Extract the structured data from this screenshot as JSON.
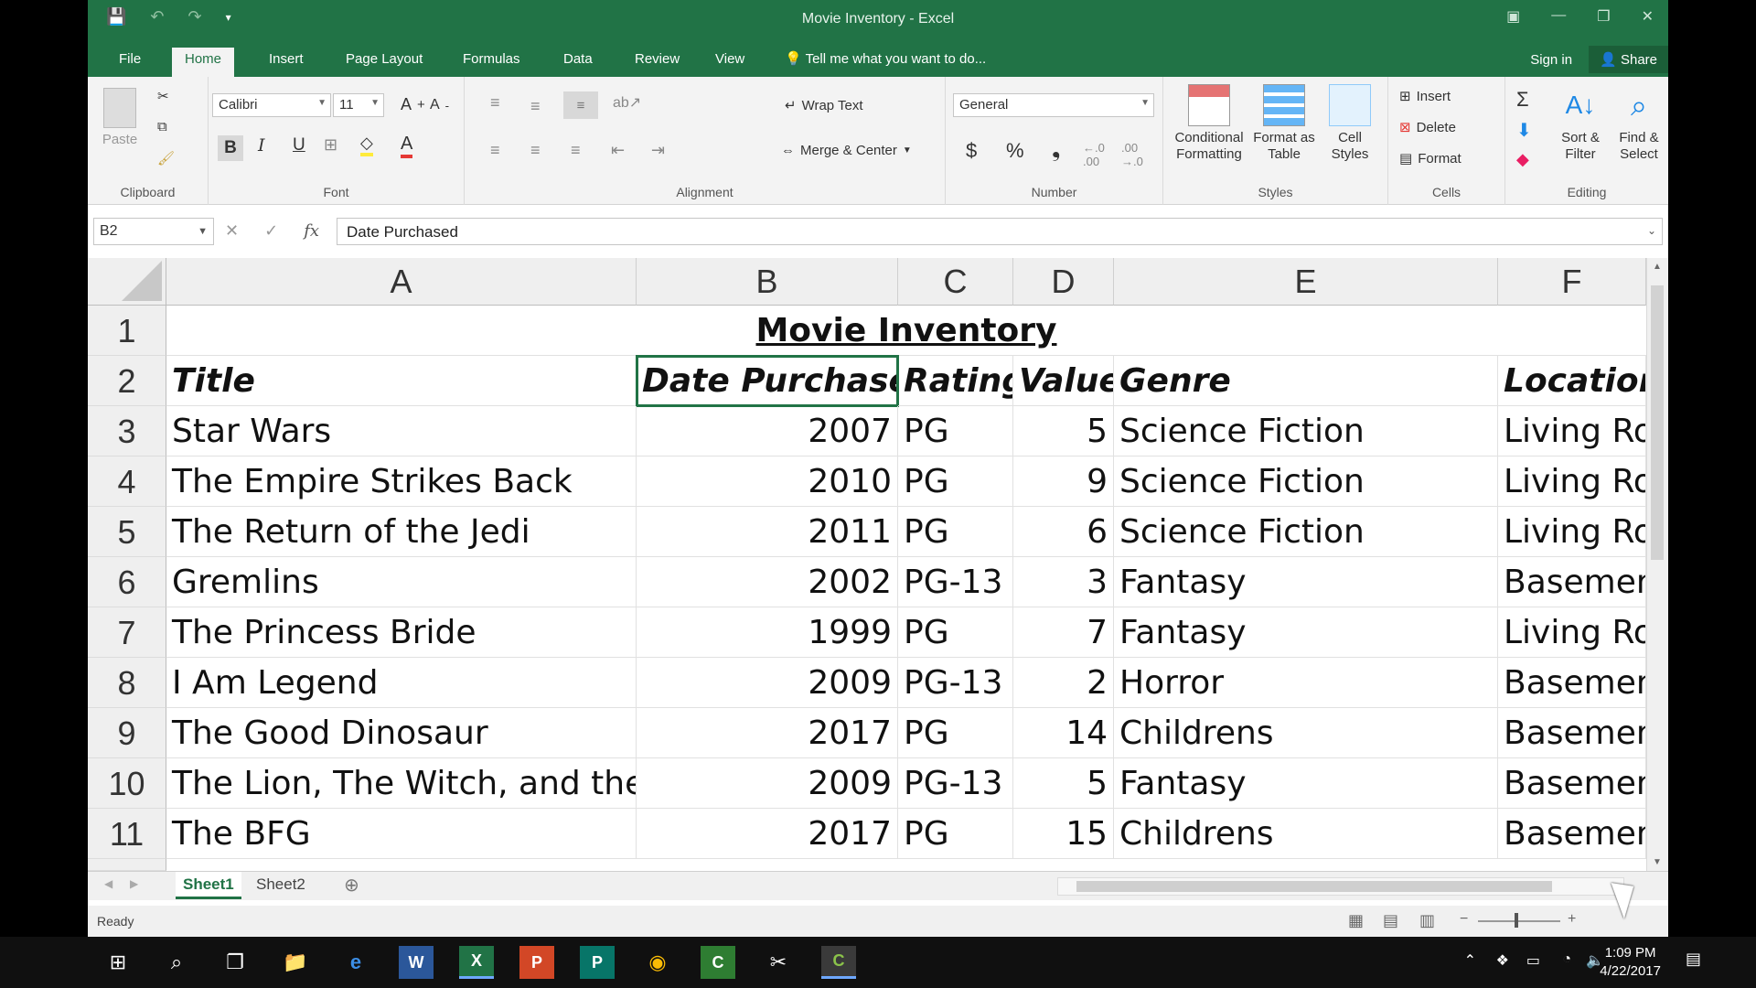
{
  "window": {
    "title": "Movie Inventory - Excel",
    "minimize_glyph": "—",
    "restore_glyph": "❐",
    "close_glyph": "✕"
  },
  "tabs": [
    "File",
    "Home",
    "Insert",
    "Page Layout",
    "Formulas",
    "Data",
    "Review",
    "View"
  ],
  "tell_me": "Tell me what you want to do...",
  "sign_in": "Sign in",
  "share": "Share",
  "ribbon": {
    "clipboard": {
      "paste": "Paste",
      "label": "Clipboard"
    },
    "font": {
      "name": "Calibri",
      "size": "11",
      "bold": "B",
      "italic": "I",
      "underline": "U",
      "label": "Font"
    },
    "alignment": {
      "wrap": "Wrap Text",
      "merge": "Merge & Center",
      "label": "Alignment"
    },
    "number": {
      "format": "General",
      "currency": "$",
      "percent": "%",
      "comma": "❟",
      "label": "Number"
    },
    "styles": {
      "conditional": [
        "Conditional",
        "Formatting"
      ],
      "format_table": [
        "Format as",
        "Table"
      ],
      "cell_styles": [
        "Cell",
        "Styles"
      ],
      "label": "Styles"
    },
    "cells": {
      "insert": "Insert",
      "delete": "Delete",
      "format": "Format",
      "label": "Cells"
    },
    "editing": {
      "sort": [
        "Sort &",
        "Filter"
      ],
      "find": [
        "Find &",
        "Select"
      ],
      "label": "Editing"
    }
  },
  "formula_bar": {
    "name_box": "B2",
    "fx": "fx",
    "content": "Date Purchased"
  },
  "columns": [
    "A",
    "B",
    "C",
    "D",
    "E",
    "F"
  ],
  "rows": [
    "1",
    "2",
    "3",
    "4",
    "5",
    "6",
    "7",
    "8",
    "9",
    "10",
    "11"
  ],
  "sheet": {
    "title": "Movie Inventory",
    "headers": [
      "Title",
      "Date Purchased",
      "Rating",
      "Value",
      "Genre",
      "Location"
    ],
    "data": [
      [
        "Star Wars",
        "2007",
        "PG",
        "5",
        "Science Fiction",
        "Living Ro"
      ],
      [
        "The Empire Strikes Back",
        "2010",
        "PG",
        "9",
        "Science Fiction",
        "Living Ro"
      ],
      [
        "The Return of the Jedi",
        "2011",
        "PG",
        "6",
        "Science Fiction",
        "Living Ro"
      ],
      [
        "Gremlins",
        "2002",
        "PG-13",
        "3",
        "Fantasy",
        "Basemen"
      ],
      [
        "The Princess Bride",
        "1999",
        "PG",
        "7",
        "Fantasy",
        "Living Ro"
      ],
      [
        "I Am Legend",
        "2009",
        "PG-13",
        "2",
        "Horror",
        "Basemen"
      ],
      [
        "The Good Dinosaur",
        "2017",
        "PG",
        "14",
        "Childrens",
        "Basemen"
      ],
      [
        "The Lion, The Witch, and the '",
        "2009",
        "PG-13",
        "5",
        "Fantasy",
        "Basemen"
      ],
      [
        "The BFG",
        "2017",
        "PG",
        "15",
        "Childrens",
        "Basemen"
      ]
    ]
  },
  "sheet_tabs": [
    "Sheet1",
    "Sheet2"
  ],
  "status": "Ready",
  "clock": {
    "time": "1:09 PM",
    "date": "4/22/2017"
  },
  "colors": {
    "excel_green": "#217346",
    "ribbon_bg": "#f3f3f3",
    "taskbar": "#101010"
  }
}
